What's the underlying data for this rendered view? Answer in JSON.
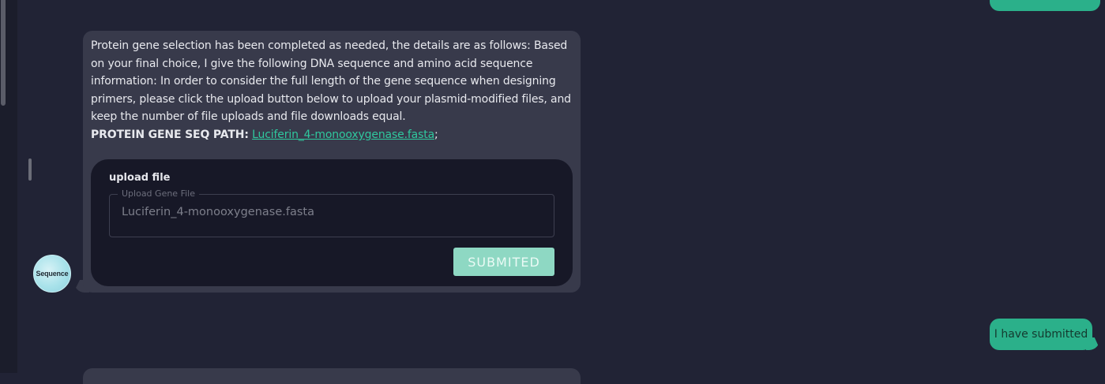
{
  "messages": {
    "bot": {
      "avatar_label": "Sequence",
      "paragraph": "Protein gene selection has been completed as needed, the details are as follows: Based on your final choice, I give the following DNA sequence and amino acid sequence information: In order to consider the full length of the gene sequence when designing primers, please click the upload button below to upload your plasmid-modified files, and keep the number of file uploads and file downloads equal.",
      "seq_path_label": "PROTEIN GENE SEQ PATH:",
      "seq_path_link": "Luciferin_4-monooxygenase.fasta",
      "seq_path_suffix": ";",
      "upload_card": {
        "title": "upload file",
        "field_legend": "Upload Gene File",
        "field_value": "Luciferin_4-monooxygenase.fasta",
        "submit_label": "SUBMITED"
      }
    },
    "user": {
      "text": "I have submitted"
    }
  },
  "colors": {
    "background": "#212335",
    "bot_bubble": "#383a4b",
    "user_bubble": "#2bb08a",
    "link": "#2fc89e",
    "submit_button": "#8ed8c3"
  }
}
